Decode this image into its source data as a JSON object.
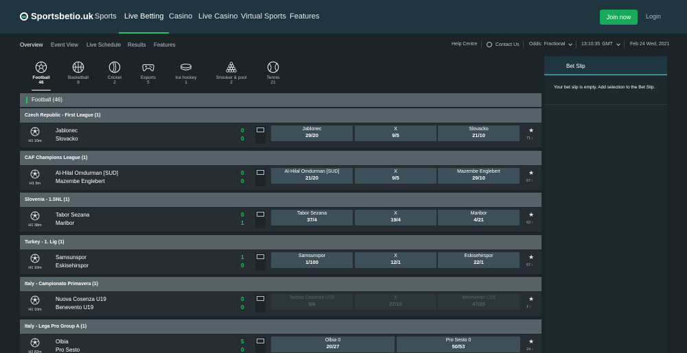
{
  "brand": {
    "name": "Sportsbetio.uk"
  },
  "colors": {
    "accent": "#23c463",
    "header_bg": "#1f3540",
    "body_bg": "#1c2428",
    "league_bg": "#556369"
  },
  "nav": {
    "items": [
      {
        "label": "Sports"
      },
      {
        "label": "Live Betting",
        "active": true
      },
      {
        "label": "Casino"
      },
      {
        "label": "Live Casino"
      },
      {
        "label": "Virtual Sports"
      },
      {
        "label": "Features"
      }
    ],
    "join_label": "Join now",
    "login_label": "Login"
  },
  "subnav": {
    "items": [
      {
        "label": "Overview",
        "active": true
      },
      {
        "label": "Event View"
      },
      {
        "label": "Live Schedule"
      },
      {
        "label": "Results"
      },
      {
        "label": "Features"
      }
    ],
    "help": "Help Centre",
    "contact": "Contact Us",
    "odds_label": "Odds:",
    "odds_value": "Fractional",
    "time": "13:10:35",
    "timezone": "GMT",
    "date": "Feb 24 Wed, 2021"
  },
  "sports": [
    {
      "label": "Football",
      "count": "46",
      "icon": "football-icon",
      "active": true
    },
    {
      "label": "Basketball",
      "count": "9",
      "icon": "basketball-icon"
    },
    {
      "label": "Cricket",
      "count": "2",
      "icon": "cricket-icon"
    },
    {
      "label": "Esports",
      "count": "5",
      "icon": "gamepad-icon"
    },
    {
      "label": "Ice hockey",
      "count": "1",
      "icon": "puck-icon"
    },
    {
      "label": "Snooker & pool",
      "count": "2",
      "icon": "snooker-icon"
    },
    {
      "label": "Tennis",
      "count": "21",
      "icon": "tennis-icon"
    }
  ],
  "list_header": "Football  (46)",
  "leagues": [
    {
      "name": "Czech Republic - First League (1)",
      "time": "H1 10m",
      "home": "Jablonec",
      "away": "Slovacko",
      "home_score": "0",
      "away_score": "0",
      "odds": [
        {
          "label": "Jablonec",
          "value": "29/20"
        },
        {
          "label": "X",
          "value": "9/5"
        },
        {
          "label": "Slovacko",
          "value": "21/10"
        }
      ],
      "markets": "71",
      "disabled": false
    },
    {
      "name": "CAF Champions League (1)",
      "time": "H1 9m",
      "home": "Al-Hilal Omdurman [SUD]",
      "away": "Mazembe Englebert",
      "home_score": "0",
      "away_score": "0",
      "odds": [
        {
          "label": "Al-Hilal Omdurman [SUD]",
          "value": "21/20"
        },
        {
          "label": "X",
          "value": "9/5"
        },
        {
          "label": "Mazembe Englebert",
          "value": "29/10"
        }
      ],
      "markets": "67",
      "disabled": false
    },
    {
      "name": "Slovenia - 1.SNL (1)",
      "time": "H1 38m",
      "home": "Tabor Sezana",
      "away": "Maribor",
      "home_score": "0",
      "away_score": "1",
      "odds": [
        {
          "label": "Tabor Sezana",
          "value": "37/4"
        },
        {
          "label": "X",
          "value": "19/4"
        },
        {
          "label": "Maribor",
          "value": "4/21"
        }
      ],
      "markets": "62",
      "disabled": false
    },
    {
      "name": "Turkey - 1. Lig (1)",
      "time": "H1 10m",
      "home": "Samsunspor",
      "away": "Eskisehirspor",
      "home_score": "1",
      "away_score": "0",
      "odds": [
        {
          "label": "Samsunspor",
          "value": "1/100"
        },
        {
          "label": "X",
          "value": "12/1"
        },
        {
          "label": "Eskisehirspor",
          "value": "22/1"
        }
      ],
      "markets": "67",
      "disabled": false
    },
    {
      "name": "Italy - Campionato Primavera (1)",
      "time": "H1 10m",
      "home": "Nuova Cosenza U19",
      "away": "Benevento U19",
      "home_score": "0",
      "away_score": "0",
      "odds": [
        {
          "label": "Nuova Cosenza U19",
          "value": "5/6"
        },
        {
          "label": "X",
          "value": "27/10"
        },
        {
          "label": "Benevento U19",
          "value": "47/20"
        }
      ],
      "markets": "1",
      "disabled": true
    },
    {
      "name": "Italy - Lega Pro Group A (1)",
      "time": "H2 82m",
      "home": "Olbia",
      "away": "Pro Sesto",
      "home_score": "5",
      "away_score": "0",
      "odds": [
        {
          "label": "Olbia  0",
          "value": "20/27"
        },
        {
          "label": "Pro Sesto  0",
          "value": "50/53"
        }
      ],
      "markets": "24",
      "disabled": false
    }
  ],
  "betslip": {
    "title": "Bet Slip",
    "message": "Your bet slip is empty. Add selection to the Bet Slip."
  }
}
